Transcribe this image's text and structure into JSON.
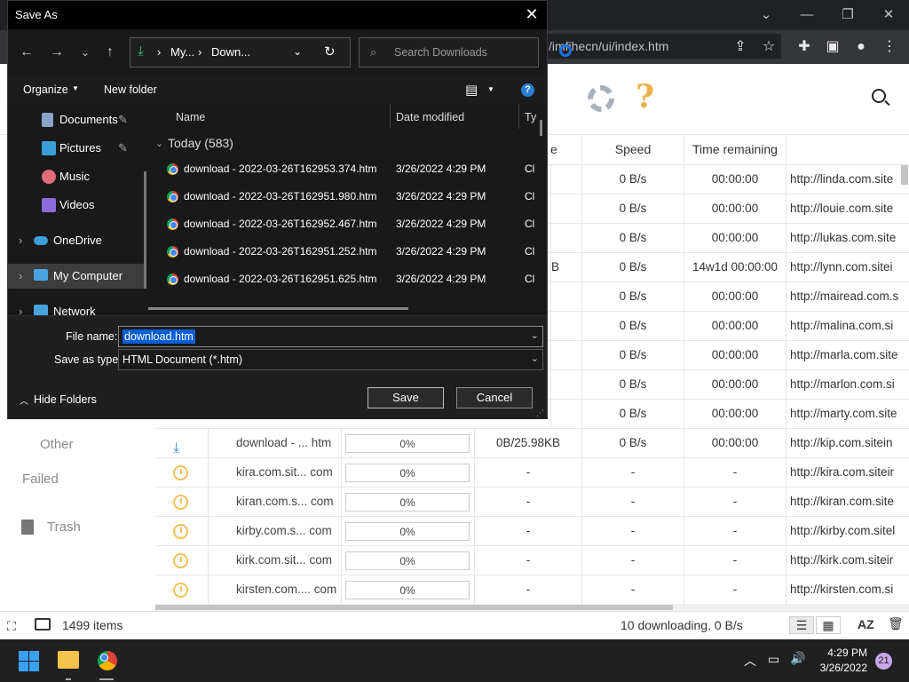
{
  "browser": {
    "url": "/imfihecn/ui/index.htm"
  },
  "app": {
    "sidebar": {
      "other": "Other",
      "failed": "Failed",
      "trash": "Trash"
    },
    "columns": [
      "e",
      "Speed",
      "Time remaining"
    ],
    "rows": [
      {
        "size": "",
        "speed": "0 B/s",
        "time": "00:00:00",
        "url": "http://linda.com.site"
      },
      {
        "size": "",
        "speed": "0 B/s",
        "time": "00:00:00",
        "url": "http://louie.com.site"
      },
      {
        "size": "",
        "speed": "0 B/s",
        "time": "00:00:00",
        "url": "http://lukas.com.site"
      },
      {
        "size": "B",
        "speed": "0 B/s",
        "time": "14w1d 00:00:00",
        "url": "http://lynn.com.sitei"
      },
      {
        "size": "",
        "speed": "0 B/s",
        "time": "00:00:00",
        "url": "http://mairead.com.s"
      },
      {
        "size": "",
        "speed": "0 B/s",
        "time": "00:00:00",
        "url": "http://malina.com.si"
      },
      {
        "size": "",
        "speed": "0 B/s",
        "time": "00:00:00",
        "url": "http://marla.com.site"
      },
      {
        "size": "",
        "speed": "0 B/s",
        "time": "00:00:00",
        "url": "http://marlon.com.si"
      },
      {
        "size": "",
        "speed": "0 B/s",
        "time": "00:00:00",
        "url": "http://marty.com.site"
      }
    ],
    "active_row": {
      "name": "download - ... htm",
      "progress": "0%",
      "size": "0B/25.98KB",
      "speed": "0 B/s",
      "time": "00:00:00",
      "url": "http://kip.com.sitein"
    },
    "queued_rows": [
      {
        "name": "kira.com.sit... com",
        "progress": "0%",
        "size": "-",
        "speed": "-",
        "time": "-",
        "url": "http://kira.com.siteir"
      },
      {
        "name": "kiran.com.s... com",
        "progress": "0%",
        "size": "-",
        "speed": "-",
        "time": "-",
        "url": "http://kiran.com.site"
      },
      {
        "name": "kirby.com.s... com",
        "progress": "0%",
        "size": "-",
        "speed": "-",
        "time": "-",
        "url": "http://kirby.com.sitel"
      },
      {
        "name": "kirk.com.sit... com",
        "progress": "0%",
        "size": "-",
        "speed": "-",
        "time": "-",
        "url": "http://kirk.com.siteir"
      },
      {
        "name": "kirsten.com.... com",
        "progress": "0%",
        "size": "-",
        "speed": "-",
        "time": "-",
        "url": "http://kirsten.com.si"
      }
    ],
    "status": {
      "items": "1499 items",
      "summary": "10 downloading, 0 B/s"
    }
  },
  "dialog": {
    "title": "Save As",
    "breadcrumb": [
      "My...",
      "Down..."
    ],
    "search_placeholder": "Search Downloads",
    "organize": "Organize",
    "new_folder": "New folder",
    "nav_items": [
      {
        "label": "Documents",
        "pinned": true
      },
      {
        "label": "Pictures",
        "pinned": true
      },
      {
        "label": "Music",
        "pinned": false
      },
      {
        "label": "Videos",
        "pinned": false
      },
      {
        "label": "OneDrive",
        "pinned": false
      },
      {
        "label": "My Computer",
        "pinned": false
      },
      {
        "label": "Network",
        "pinned": false
      }
    ],
    "columns": {
      "name": "Name",
      "date": "Date modified",
      "type": "Ty"
    },
    "group": "Today (583)",
    "files": [
      {
        "name": "download - 2022-03-26T162953.374.htm",
        "date": "3/26/2022 4:29 PM",
        "type": "Cl"
      },
      {
        "name": "download - 2022-03-26T162951.980.htm",
        "date": "3/26/2022 4:29 PM",
        "type": "Cl"
      },
      {
        "name": "download - 2022-03-26T162952.467.htm",
        "date": "3/26/2022 4:29 PM",
        "type": "Cl"
      },
      {
        "name": "download - 2022-03-26T162951.252.htm",
        "date": "3/26/2022 4:29 PM",
        "type": "Cl"
      },
      {
        "name": "download - 2022-03-26T162951.625.htm",
        "date": "3/26/2022 4:29 PM",
        "type": "Cl"
      }
    ],
    "file_name_label": "File name:",
    "file_name_value": "download.htm",
    "save_type_label": "Save as type:",
    "save_type_value": "HTML Document (*.htm)",
    "hide_folders": "Hide Folders",
    "save": "Save",
    "cancel": "Cancel"
  },
  "taskbar": {
    "time": "4:29 PM",
    "date": "3/26/2022",
    "badge": "21"
  }
}
